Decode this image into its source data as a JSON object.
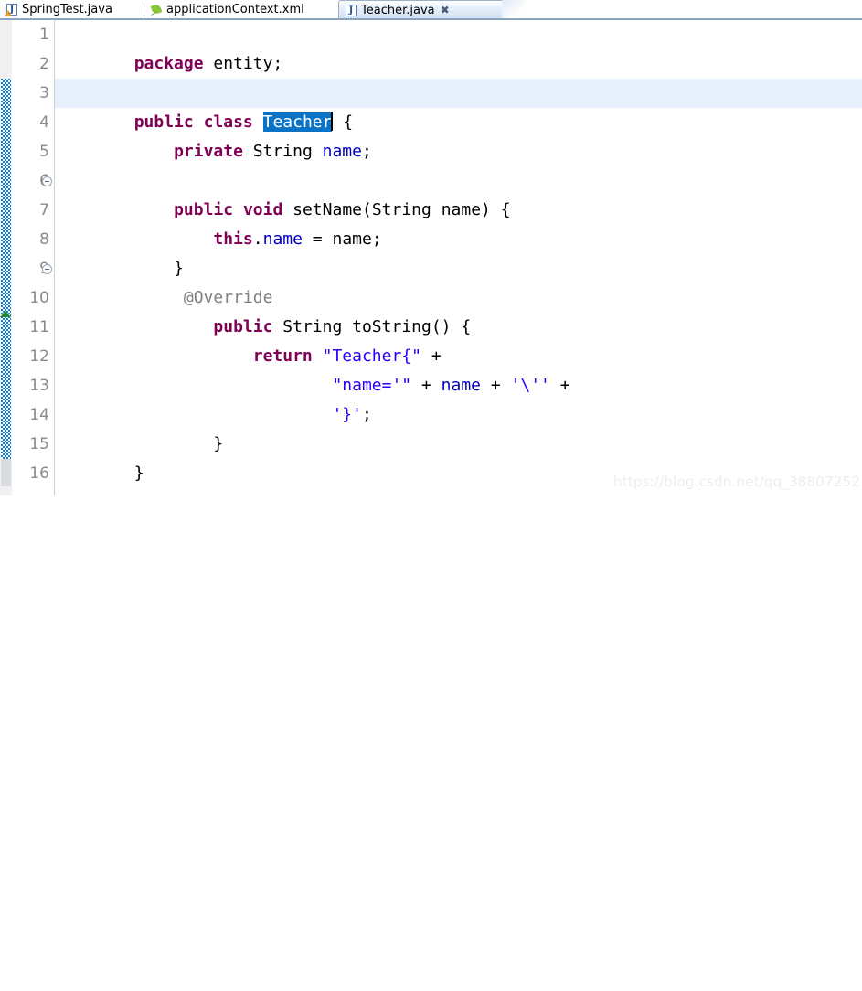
{
  "window": {
    "application": "Eclipse IDE",
    "active_file": "Teacher.java"
  },
  "tabs": [
    {
      "label": "SpringTest.java",
      "icon": "java-file-warning-icon",
      "active": false,
      "closable": false
    },
    {
      "label": "applicationContext.xml",
      "icon": "spring-xml-leaf-icon",
      "active": false,
      "closable": false
    },
    {
      "label": "Teacher.java",
      "icon": "java-file-icon",
      "active": true,
      "closable": true,
      "close_glyph": "✖"
    }
  ],
  "editor": {
    "line_numbers": [
      "1",
      "2",
      "3",
      "4",
      "5",
      "6",
      "7",
      "8",
      "9",
      "10",
      "11",
      "12",
      "13",
      "14",
      "15",
      "16"
    ],
    "current_line": 3,
    "selection_text": "Teacher",
    "fold_markers_on_lines": [
      6,
      9
    ],
    "override_marker_line": 10,
    "change_bar_lines": [
      3,
      15
    ],
    "lines": [
      {
        "n": 1,
        "text": "package entity;"
      },
      {
        "n": 2,
        "text": ""
      },
      {
        "n": 3,
        "text": "public class Teacher {"
      },
      {
        "n": 4,
        "text": "    private String name;"
      },
      {
        "n": 5,
        "text": ""
      },
      {
        "n": 6,
        "text": "    public void setName(String name) {"
      },
      {
        "n": 7,
        "text": "        this.name = name;"
      },
      {
        "n": 8,
        "text": "    }"
      },
      {
        "n": 9,
        "text": "     @Override"
      },
      {
        "n": 10,
        "text": "        public String toString() {"
      },
      {
        "n": 11,
        "text": "            return \"Teacher{\" +"
      },
      {
        "n": 12,
        "text": "                    \"name='\" + name + '\\'' +"
      },
      {
        "n": 13,
        "text": "                    '}';"
      },
      {
        "n": 14,
        "text": "        }"
      },
      {
        "n": 15,
        "text": "}"
      },
      {
        "n": 16,
        "text": ""
      }
    ],
    "tokens": {
      "l1_kw": "package",
      "l1_rest": " entity;",
      "l3_kw1": "public",
      "l3_sp1": " ",
      "l3_kw2": "class",
      "l3_sp2": " ",
      "l3_sel": "Teacher",
      "l3_tail": " {",
      "l4_indent": "    ",
      "l4_kw": "private",
      "l4_mid": " String ",
      "l4_field": "name",
      "l4_tail": ";",
      "l6_indent": "    ",
      "l6_kw1": "public",
      "l6_sp1": " ",
      "l6_kw2": "void",
      "l6_rest": " setName(String name) {",
      "l7_indent": "        ",
      "l7_kw": "this",
      "l7_dot": ".",
      "l7_field": "name",
      "l7_rest": " = name;",
      "l8_text": "    }",
      "l9_text": "     @Override",
      "l10_indent": "        ",
      "l10_kw": "public",
      "l10_rest": " String toString() {",
      "l11_indent": "            ",
      "l11_kw": "return",
      "l11_sp": " ",
      "l11_str": "\"Teacher{\"",
      "l11_tail": " +",
      "l12_indent": "                    ",
      "l12_str1": "\"name='\"",
      "l12_mid": " + ",
      "l12_field": "name",
      "l12_mid2": " + ",
      "l12_str2": "'\\''",
      "l12_tail": " +",
      "l13_indent": "                    ",
      "l13_str": "'}'",
      "l13_tail": ";",
      "l14_text": "        }",
      "l15_text": "}"
    }
  },
  "watermark": {
    "text": "https://blog.csdn.net/qq_38807252"
  },
  "colors": {
    "keyword": "#7f0055",
    "string": "#2a00ff",
    "field": "#0000c0",
    "annotation": "#808080",
    "selection": "#0a73c6",
    "current_line": "#e8f0fd",
    "change_bar": "#0f7fd4",
    "override_marker": "#1f8b2e",
    "gutter_text": "#8a8a8a"
  }
}
